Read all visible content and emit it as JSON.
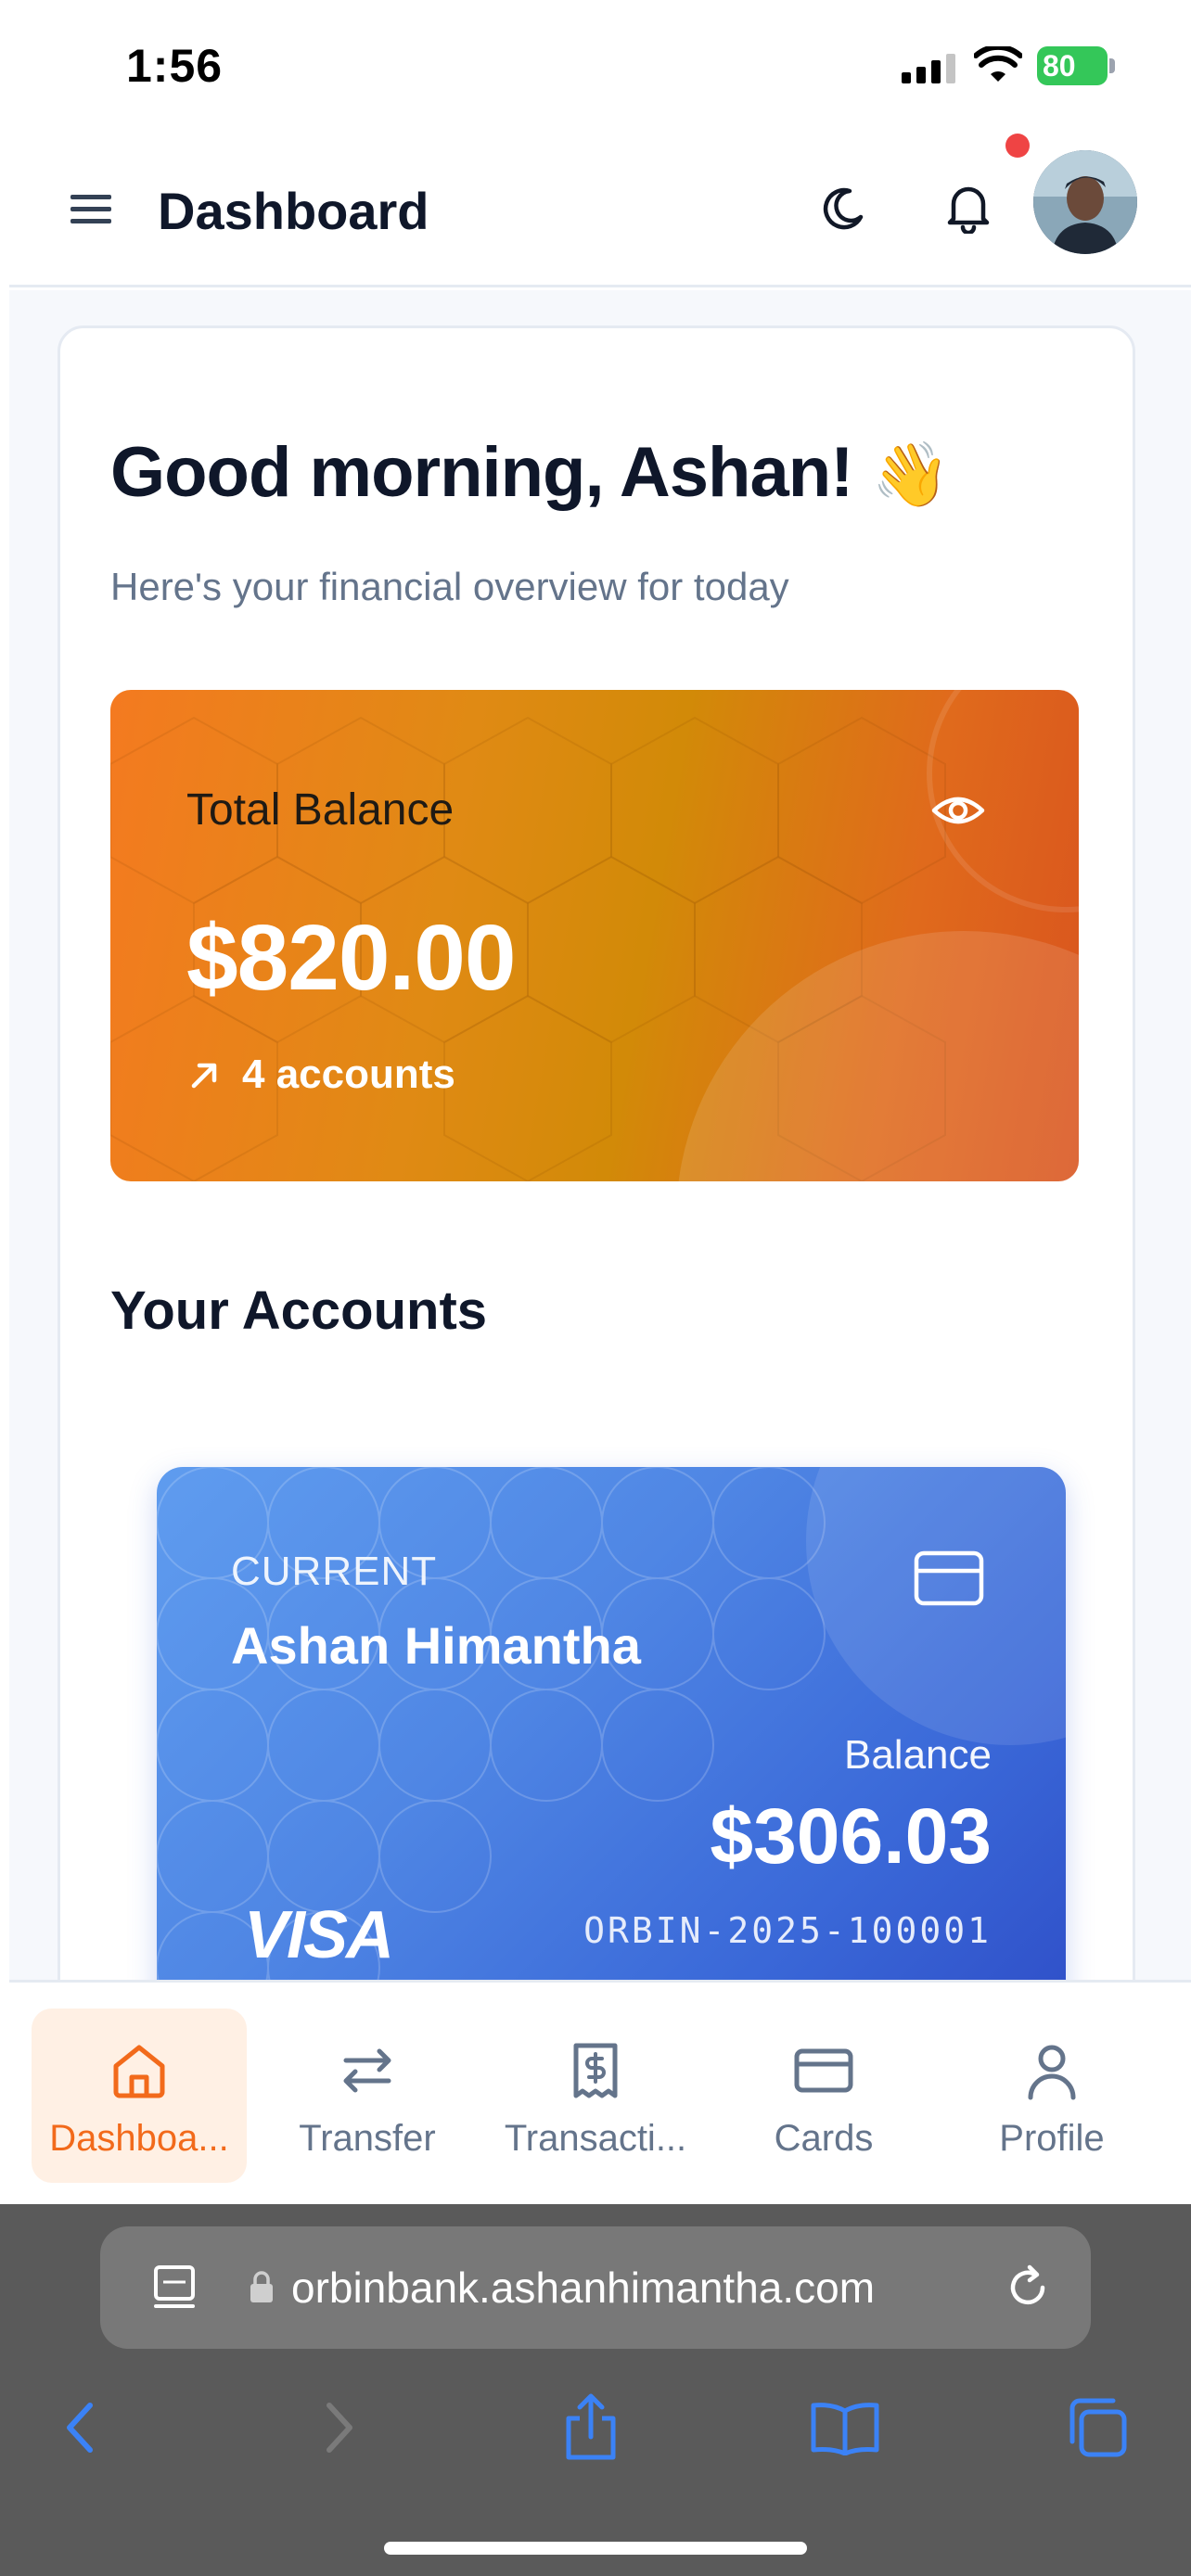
{
  "status_bar": {
    "time": "1:56",
    "battery": "80"
  },
  "header": {
    "title": "Dashboard"
  },
  "greeting": {
    "text": "Good morning, Ashan!",
    "emoji": "👋",
    "subtitle": "Here's your financial overview for today"
  },
  "balance": {
    "label": "Total Balance",
    "amount": "$820.00",
    "accounts": "4 accounts"
  },
  "accounts_section": {
    "title": "Your Accounts"
  },
  "account_card": {
    "type": "CURRENT",
    "name": "Ashan Himantha",
    "balance_label": "Balance",
    "balance": "$306.03",
    "brand": "VISA",
    "number": "ORBIN-2025-100001"
  },
  "nav": [
    {
      "label": "Dashboa...",
      "icon": "home-icon",
      "active": true
    },
    {
      "label": "Transfer",
      "icon": "transfer-icon",
      "active": false
    },
    {
      "label": "Transacti...",
      "icon": "receipt-icon",
      "active": false
    },
    {
      "label": "Cards",
      "icon": "card-icon",
      "active": false
    },
    {
      "label": "Profile",
      "icon": "user-icon",
      "active": false
    }
  ],
  "browser": {
    "url": "orbinbank.ashanhimantha.com"
  },
  "colors": {
    "accent": "#f26a1b",
    "balance_card": "#e08a14",
    "account_card": "#4f86e4",
    "notification": "#ef4444",
    "safari_ui": "#5a5a5a",
    "ios_link": "#3b82f6"
  }
}
